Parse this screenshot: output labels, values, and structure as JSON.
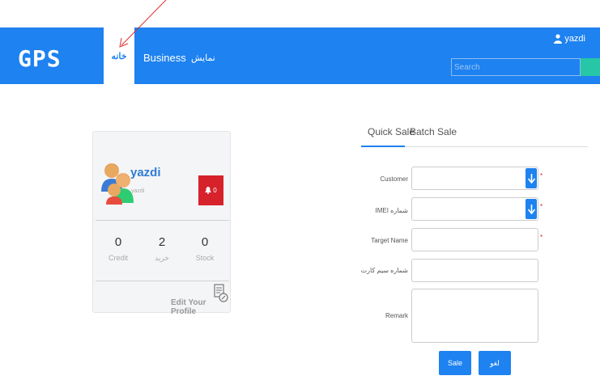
{
  "navbar": {
    "logo": "GPS",
    "home_label": "خانه",
    "business_label": "Business",
    "display_label": "نمایش",
    "username": "yazdi",
    "search_placeholder": "Search"
  },
  "profile": {
    "username": "yazdi",
    "subtitle": "yazdi",
    "notification_count": "0",
    "stats": [
      {
        "value": "0",
        "label": "Credit"
      },
      {
        "value": "2",
        "label": "خرید"
      },
      {
        "value": "0",
        "label": "Stock"
      }
    ],
    "edit_label": "Edit Your Profile"
  },
  "tabs": [
    {
      "label": "Quick Sale",
      "active": true
    },
    {
      "label": "Batch Sale",
      "active": false
    }
  ],
  "form": {
    "customer_label": "Customer",
    "imei_label": "IMEI شماره",
    "target_label": "Target Name",
    "sim_label": "شماره سیم کارت",
    "remark_label": "Remark",
    "required_mark": "*",
    "sale_button": "Sale",
    "cancel_button": "لغو"
  },
  "colors": {
    "primary": "#1e82f0",
    "danger": "#d6222b",
    "accent": "#26c6a6"
  }
}
